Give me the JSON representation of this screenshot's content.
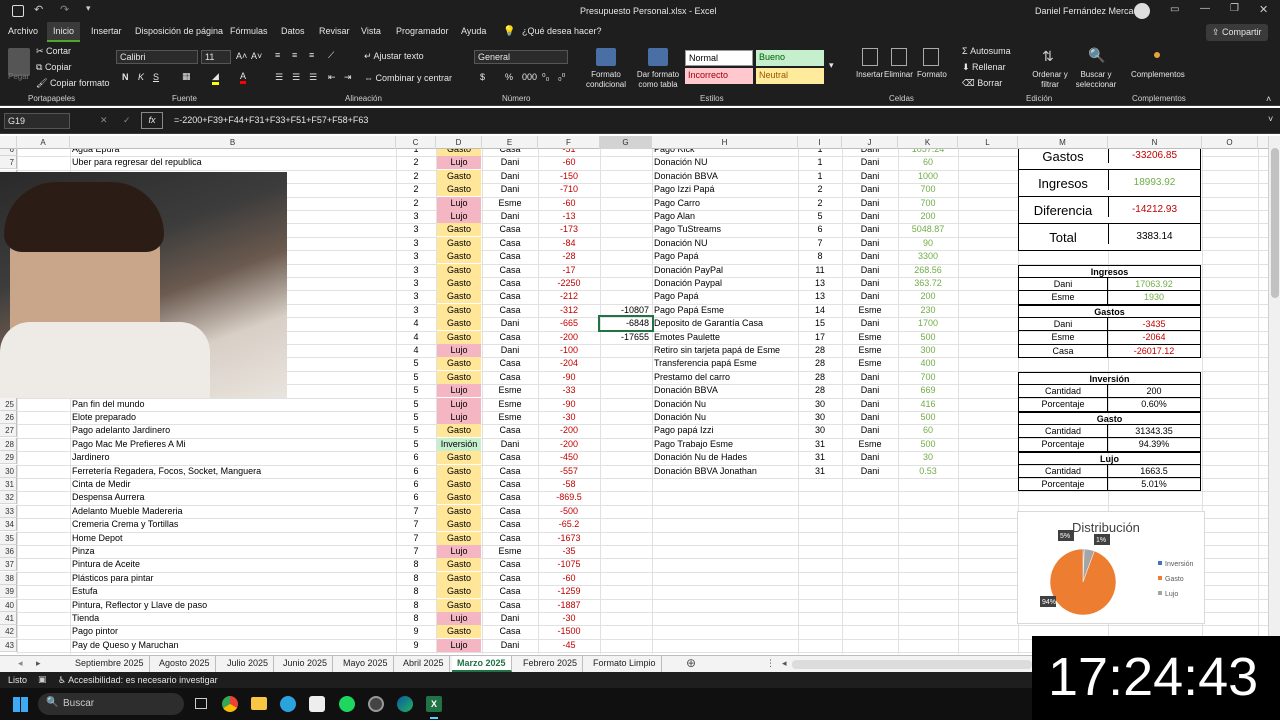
{
  "title": {
    "file": "Presupuesto Personal.xlsx  -  Excel",
    "user": "Daniel Fernández Mercado",
    "share": "Compartir"
  },
  "tabs": [
    "Archivo",
    "Inicio",
    "Insertar",
    "Disposición de página",
    "Fórmulas",
    "Datos",
    "Revisar",
    "Vista",
    "Programador",
    "Ayuda",
    "¿Qué desea hacer?"
  ],
  "ribbon": {
    "clipboard": {
      "paste": "Pegar",
      "cut": "Cortar",
      "copy": "Copiar",
      "format": "Copiar formato",
      "group": "Portapapeles"
    },
    "font": {
      "name": "Calibri",
      "size": "11",
      "group": "Fuente",
      "bold": "N",
      "italic": "K",
      "underline": "S"
    },
    "align": {
      "wrap": "Ajustar texto",
      "merge": "Combinar y centrar",
      "group": "Alineación"
    },
    "number": {
      "format": "General",
      "group": "Número"
    },
    "styles": {
      "cond": "Formato condicional",
      "table": "Dar formato como tabla",
      "normal": "Normal",
      "bueno": "Bueno",
      "incorrecto": "Incorrecto",
      "neutral": "Neutral",
      "group": "Estilos"
    },
    "cells": {
      "insert": "Insertar",
      "delete": "Eliminar",
      "format": "Formato",
      "group": "Celdas"
    },
    "editing": {
      "autosum": "Autosuma",
      "fill": "Rellenar",
      "clear": "Borrar",
      "sort": "Ordenar y filtrar",
      "find": "Buscar y seleccionar",
      "group": "Edición"
    },
    "addins": {
      "btn": "Complementos",
      "group": "Complementos"
    }
  },
  "formula": {
    "namebox": "G19",
    "content": "=-2200+F39+F44+F31+F33+F51+F57+F58+F63"
  },
  "columns": [
    "A",
    "B",
    "C",
    "D",
    "E",
    "F",
    "G",
    "H",
    "I",
    "J",
    "K",
    "L",
    "M",
    "N",
    "O"
  ],
  "rows": [
    {
      "n": "6",
      "b": "Agua Epura",
      "c": "1",
      "d": "Gasto",
      "e": "Casa",
      "f": "-51"
    },
    {
      "n": "7",
      "b": "Uber para regresar del republica",
      "c": "2",
      "d": "Lujo",
      "e": "Dani",
      "f": "-60"
    },
    {
      "n": "8",
      "b": "",
      "c": "2",
      "d": "Gasto",
      "e": "Dani",
      "f": "-150"
    },
    {
      "n": "9",
      "b": "",
      "c": "2",
      "d": "Gasto",
      "e": "Dani",
      "f": "-710"
    },
    {
      "n": "10",
      "b": "",
      "c": "2",
      "d": "Lujo",
      "e": "Esme",
      "f": "-60"
    },
    {
      "n": "11",
      "b": "",
      "c": "3",
      "d": "Lujo",
      "e": "Dani",
      "f": "-13"
    },
    {
      "n": "12",
      "b": "",
      "c": "3",
      "d": "Gasto",
      "e": "Casa",
      "f": "-173"
    },
    {
      "n": "13",
      "b": "",
      "c": "3",
      "d": "Gasto",
      "e": "Casa",
      "f": "-84"
    },
    {
      "n": "14",
      "b": "",
      "c": "3",
      "d": "Gasto",
      "e": "Casa",
      "f": "-28"
    },
    {
      "n": "15",
      "b": "",
      "c": "3",
      "d": "Gasto",
      "e": "Casa",
      "f": "-17"
    },
    {
      "n": "16",
      "b": "",
      "c": "3",
      "d": "Gasto",
      "e": "Casa",
      "f": "-2250"
    },
    {
      "n": "17",
      "b": "",
      "c": "3",
      "d": "Gasto",
      "e": "Casa",
      "f": "-212"
    },
    {
      "n": "18",
      "b": "",
      "c": "3",
      "d": "Gasto",
      "e": "Casa",
      "f": "-312"
    },
    {
      "n": "19",
      "b": "",
      "c": "4",
      "d": "Gasto",
      "e": "Dani",
      "f": "-665"
    },
    {
      "n": "20",
      "b": "",
      "c": "4",
      "d": "Gasto",
      "e": "Casa",
      "f": "-200"
    },
    {
      "n": "21",
      "b": "",
      "c": "4",
      "d": "Lujo",
      "e": "Dani",
      "f": "-100"
    },
    {
      "n": "22",
      "b": "",
      "c": "5",
      "d": "Gasto",
      "e": "Casa",
      "f": "-204"
    },
    {
      "n": "23",
      "b": "",
      "c": "5",
      "d": "Gasto",
      "e": "Casa",
      "f": "-90"
    },
    {
      "n": "24",
      "b": "",
      "c": "5",
      "d": "Lujo",
      "e": "Esme",
      "f": "-33"
    },
    {
      "n": "25",
      "b": "Pan fin del mundo",
      "c": "5",
      "d": "Lujo",
      "e": "Esme",
      "f": "-90"
    },
    {
      "n": "26",
      "b": "Elote preparado",
      "c": "5",
      "d": "Lujo",
      "e": "Esme",
      "f": "-30"
    },
    {
      "n": "27",
      "b": "Pago adelanto Jardinero",
      "c": "5",
      "d": "Gasto",
      "e": "Casa",
      "f": "-200"
    },
    {
      "n": "28",
      "b": "Pago Mac Me Prefieres A Mi",
      "c": "5",
      "d": "Inversión",
      "e": "Dani",
      "f": "-200"
    },
    {
      "n": "29",
      "b": "Jardinero",
      "c": "6",
      "d": "Gasto",
      "e": "Casa",
      "f": "-450"
    },
    {
      "n": "30",
      "b": "Ferretería Regadera, Focos, Socket, Manguera",
      "c": "6",
      "d": "Gasto",
      "e": "Casa",
      "f": "-557"
    },
    {
      "n": "31",
      "b": "Cinta de Medir",
      "c": "6",
      "d": "Gasto",
      "e": "Casa",
      "f": "-58"
    },
    {
      "n": "32",
      "b": "Despensa Aurrera",
      "c": "6",
      "d": "Gasto",
      "e": "Casa",
      "f": "-869.5"
    },
    {
      "n": "33",
      "b": "Adelanto Mueble Madereria",
      "c": "7",
      "d": "Gasto",
      "e": "Casa",
      "f": "-500"
    },
    {
      "n": "34",
      "b": "Cremeria Crema y Tortillas",
      "c": "7",
      "d": "Gasto",
      "e": "Casa",
      "f": "-65.2"
    },
    {
      "n": "35",
      "b": "Home Depot",
      "c": "7",
      "d": "Gasto",
      "e": "Casa",
      "f": "-1673"
    },
    {
      "n": "36",
      "b": "Pinza",
      "c": "7",
      "d": "Lujo",
      "e": "Esme",
      "f": "-35"
    },
    {
      "n": "37",
      "b": "Pintura de Aceite",
      "c": "8",
      "d": "Gasto",
      "e": "Casa",
      "f": "-1075"
    },
    {
      "n": "38",
      "b": "Plásticos para pintar",
      "c": "8",
      "d": "Gasto",
      "e": "Casa",
      "f": "-60"
    },
    {
      "n": "39",
      "b": "Estufa",
      "c": "8",
      "d": "Gasto",
      "e": "Casa",
      "f": "-1259"
    },
    {
      "n": "40",
      "b": "Pintura, Reflector y Llave de paso",
      "c": "8",
      "d": "Gasto",
      "e": "Casa",
      "f": "-1887"
    },
    {
      "n": "41",
      "b": "Tienda",
      "c": "8",
      "d": "Lujo",
      "e": "Dani",
      "f": "-30"
    },
    {
      "n": "42",
      "b": "Pago pintor",
      "c": "9",
      "d": "Gasto",
      "e": "Casa",
      "f": "-1500"
    },
    {
      "n": "43",
      "b": "Pay de Queso y Maruchan",
      "c": "9",
      "d": "Lujo",
      "e": "Dani",
      "f": "-45"
    }
  ],
  "g_values": {
    "18": "-10807",
    "19": "-6848",
    "20": "-17655"
  },
  "income": [
    {
      "h": "Pago Kick",
      "i": "1",
      "j": "Dani",
      "k": "1057.24"
    },
    {
      "h": "Donación NU",
      "i": "1",
      "j": "Dani",
      "k": "60"
    },
    {
      "h": "Donación BBVA",
      "i": "1",
      "j": "Dani",
      "k": "1000"
    },
    {
      "h": "Pago Izzi Papá",
      "i": "2",
      "j": "Dani",
      "k": "700"
    },
    {
      "h": "Pago Carro",
      "i": "2",
      "j": "Dani",
      "k": "700"
    },
    {
      "h": "Pago Alan",
      "i": "5",
      "j": "Dani",
      "k": "200"
    },
    {
      "h": "Pago TuStreams",
      "i": "6",
      "j": "Dani",
      "k": "5048.87"
    },
    {
      "h": "Donación NU",
      "i": "7",
      "j": "Dani",
      "k": "90"
    },
    {
      "h": "Pago Papá",
      "i": "8",
      "j": "Dani",
      "k": "3300"
    },
    {
      "h": "Donación PayPal",
      "i": "11",
      "j": "Dani",
      "k": "268.56"
    },
    {
      "h": "Donación Paypal",
      "i": "13",
      "j": "Dani",
      "k": "363.72"
    },
    {
      "h": "Pago Papá",
      "i": "13",
      "j": "Dani",
      "k": "200"
    },
    {
      "h": "Pago Papá Esme",
      "i": "14",
      "j": "Esme",
      "k": "230"
    },
    {
      "h": "Deposito de Garantía Casa",
      "i": "15",
      "j": "Dani",
      "k": "1700"
    },
    {
      "h": "Emotes Paulette",
      "i": "17",
      "j": "Esme",
      "k": "500"
    },
    {
      "h": "Retiro sin tarjeta papá de Esme",
      "i": "28",
      "j": "Esme",
      "k": "300"
    },
    {
      "h": "Transferencia papá Esme",
      "i": "28",
      "j": "Esme",
      "k": "400"
    },
    {
      "h": "Prestamo del carro",
      "i": "28",
      "j": "Dani",
      "k": "700"
    },
    {
      "h": "Donación BBVA",
      "i": "28",
      "j": "Dani",
      "k": "669"
    },
    {
      "h": "Donación Nu",
      "i": "30",
      "j": "Dani",
      "k": "416"
    },
    {
      "h": "Donación Nu",
      "i": "30",
      "j": "Dani",
      "k": "500"
    },
    {
      "h": "Pago papá Izzi",
      "i": "30",
      "j": "Dani",
      "k": "60"
    },
    {
      "h": "Pago Trabajo Esme",
      "i": "31",
      "j": "Esme",
      "k": "500"
    },
    {
      "h": "Donación Nu de Hades",
      "i": "31",
      "j": "Dani",
      "k": "30"
    },
    {
      "h": "Donación BBVA Jonathan",
      "i": "31",
      "j": "Dani",
      "k": "0.53"
    }
  ],
  "summary": [
    {
      "label": "Gastos",
      "value": "-33206.85"
    },
    {
      "label": "Ingresos",
      "value": "18993.92"
    },
    {
      "label": "Diferencia",
      "value": "-14212.93"
    },
    {
      "label": "Total",
      "value": "3383.14"
    }
  ],
  "ingresos": {
    "title": "Ingresos",
    "rows": [
      {
        "k": "Dani",
        "v": "17063.92"
      },
      {
        "k": "Esme",
        "v": "1930"
      }
    ]
  },
  "gastos": {
    "title": "Gastos",
    "rows": [
      {
        "k": "Dani",
        "v": "-3435"
      },
      {
        "k": "Esme",
        "v": "-2064"
      },
      {
        "k": "Casa",
        "v": "-26017.12"
      }
    ]
  },
  "inversion": {
    "title": "Inversión",
    "cantidad": "200",
    "porcentaje": "0.60%"
  },
  "gasto": {
    "title": "Gasto",
    "cantidad": "31343.35",
    "porcentaje": "94.39%"
  },
  "lujo": {
    "title": "Lujo",
    "cantidad": "1663.5",
    "porcentaje": "5.01%"
  },
  "labels": {
    "cantidad": "Cantidad",
    "porcentaje": "Porcentaje"
  },
  "chart_data": {
    "type": "pie",
    "title": "Distribución",
    "categories": [
      "Inversión",
      "Gasto",
      "Lujo"
    ],
    "values": [
      0.6,
      94.39,
      5.01
    ],
    "data_labels": [
      "1%",
      "94%",
      "5%"
    ],
    "colors": [
      "#4472c4",
      "#ed7d31",
      "#a5a5a5"
    ],
    "legend": "right"
  },
  "sheets": [
    "Septiembre 2025",
    "Agosto 2025",
    "Julio 2025",
    "Junio 2025",
    "Mayo 2025",
    "Abril 2025",
    "Marzo 2025",
    "Febrero 2025",
    "Formato Limpio"
  ],
  "active_sheet": "Marzo 2025",
  "status": {
    "ready": "Listo",
    "access": "Accesibilidad: es necesario investigar"
  },
  "clock": "17:24:43",
  "search": "Buscar",
  "colors": {
    "gasto": "#ffe699",
    "lujo": "#f4b6c2",
    "inversion": "#c6efce",
    "neg": "#c00000",
    "pos": "#70ad47",
    "excel_green": "#217346"
  }
}
